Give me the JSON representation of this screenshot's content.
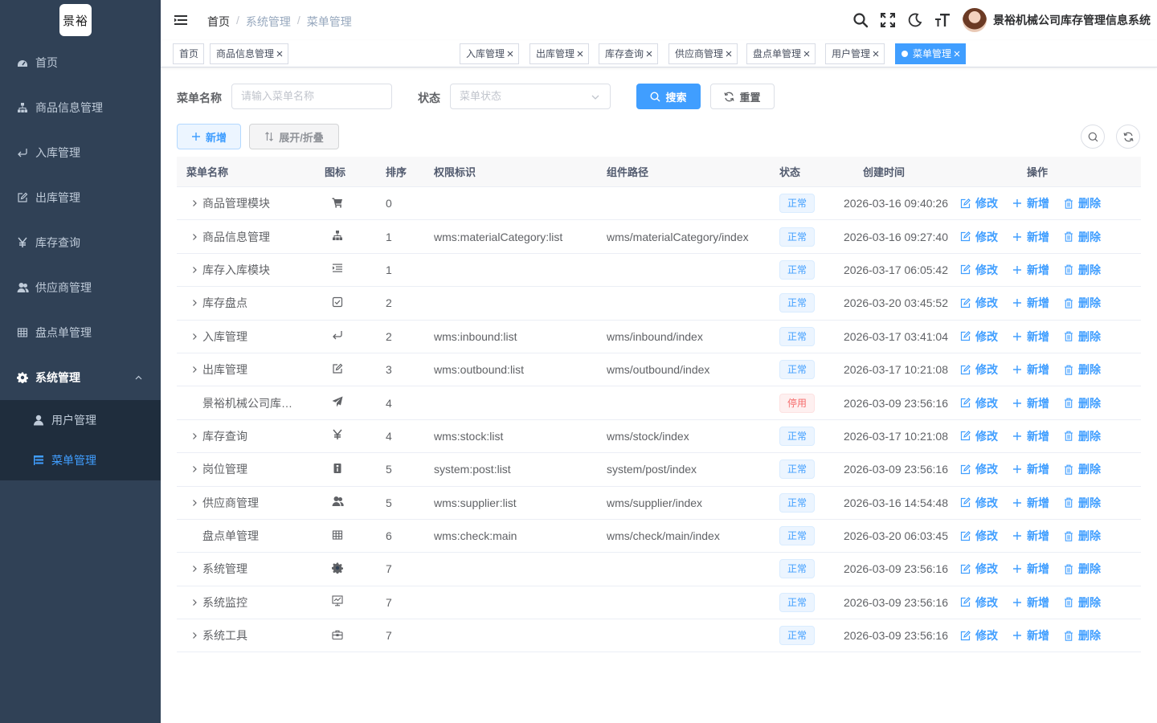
{
  "logo": {
    "text": "景裕"
  },
  "sidebar": {
    "items": [
      {
        "label": "首页",
        "icon": "dashboard-icon"
      },
      {
        "label": "商品信息管理",
        "icon": "tree-icon"
      },
      {
        "label": "入库管理",
        "icon": "enter-icon"
      },
      {
        "label": "出库管理",
        "icon": "edit-icon"
      },
      {
        "label": "库存查询",
        "icon": "yen-icon"
      },
      {
        "label": "供应商管理",
        "icon": "peoples-icon"
      },
      {
        "label": "盘点单管理",
        "icon": "table-icon"
      },
      {
        "label": "系统管理",
        "icon": "gear-icon"
      }
    ],
    "sub_items": [
      {
        "label": "用户管理",
        "icon": "user-icon"
      },
      {
        "label": "菜单管理",
        "icon": "tree-table-icon"
      }
    ]
  },
  "navbar": {
    "breadcrumb": [
      "首页",
      "系统管理",
      "菜单管理"
    ],
    "system_name": "景裕机械公司库存管理信息系统"
  },
  "tags": [
    {
      "label": "首页",
      "closable": false
    },
    {
      "label": "商品信息管理",
      "closable": true
    },
    {
      "label": "入库管理",
      "closable": true
    },
    {
      "label": "出库管理",
      "closable": true
    },
    {
      "label": "库存查询",
      "closable": true
    },
    {
      "label": "供应商管理",
      "closable": true
    },
    {
      "label": "盘点单管理",
      "closable": true
    },
    {
      "label": "用户管理",
      "closable": true
    },
    {
      "label": "菜单管理",
      "closable": true,
      "active": true
    }
  ],
  "search": {
    "name_label": "菜单名称",
    "name_placeholder": "请输入菜单名称",
    "status_label": "状态",
    "status_placeholder": "菜单状态",
    "search_button": "搜索",
    "reset_button": "重置"
  },
  "toolbar": {
    "add_button": "新增",
    "expand_button": "展开/折叠"
  },
  "table": {
    "columns": [
      "菜单名称",
      "图标",
      "排序",
      "权限标识",
      "组件路径",
      "状态",
      "创建时间",
      "操作"
    ],
    "ops": {
      "edit": "修改",
      "add": "新增",
      "delete": "删除"
    },
    "rows": [
      {
        "name": "商品管理模块",
        "expandable": true,
        "icon": "shopping-cart-icon",
        "sort": "0",
        "perm": "",
        "comp": "",
        "status": "正常",
        "time": "2026-03-16 09:40:26"
      },
      {
        "name": "商品信息管理",
        "expandable": true,
        "icon": "tree-icon",
        "sort": "1",
        "perm": "wms:materialCategory:list",
        "comp": "wms/materialCategory/index",
        "status": "正常",
        "time": "2026-03-16 09:27:40"
      },
      {
        "name": "库存入库模块",
        "expandable": true,
        "icon": "list-indent-icon",
        "sort": "1",
        "perm": "",
        "comp": "",
        "status": "正常",
        "time": "2026-03-17 06:05:42"
      },
      {
        "name": "库存盘点",
        "expandable": true,
        "icon": "checkbox-icon",
        "sort": "2",
        "perm": "",
        "comp": "",
        "status": "正常",
        "time": "2026-03-20 03:45:52"
      },
      {
        "name": "入库管理",
        "expandable": true,
        "icon": "enter-icon",
        "sort": "2",
        "perm": "wms:inbound:list",
        "comp": "wms/inbound/index",
        "status": "正常",
        "time": "2026-03-17 03:41:04"
      },
      {
        "name": "出库管理",
        "expandable": true,
        "icon": "edit-icon",
        "sort": "3",
        "perm": "wms:outbound:list",
        "comp": "wms/outbound/index",
        "status": "正常",
        "time": "2026-03-17 10:21:08"
      },
      {
        "name": "景裕机械公司库存管理信息系统",
        "expandable": false,
        "icon": "send-icon",
        "sort": "4",
        "perm": "",
        "comp": "",
        "status": "停用",
        "disabled": true,
        "time": "2026-03-09 23:56:16"
      },
      {
        "name": "库存查询",
        "expandable": true,
        "icon": "yen-icon",
        "sort": "4",
        "perm": "wms:stock:list",
        "comp": "wms/stock/index",
        "status": "正常",
        "time": "2026-03-17 10:21:08"
      },
      {
        "name": "岗位管理",
        "expandable": true,
        "icon": "post-icon",
        "sort": "5",
        "perm": "system:post:list",
        "comp": "system/post/index",
        "status": "正常",
        "time": "2026-03-09 23:56:16"
      },
      {
        "name": "供应商管理",
        "expandable": true,
        "icon": "peoples-icon",
        "sort": "5",
        "perm": "wms:supplier:list",
        "comp": "wms/supplier/index",
        "status": "正常",
        "time": "2026-03-16 14:54:48"
      },
      {
        "name": "盘点单管理",
        "expandable": false,
        "icon": "table-icon",
        "sort": "6",
        "perm": "wms:check:main",
        "comp": "wms/check/main/index",
        "status": "正常",
        "time": "2026-03-20 06:03:45"
      },
      {
        "name": "系统管理",
        "expandable": true,
        "icon": "gear-icon",
        "sort": "7",
        "perm": "",
        "comp": "",
        "status": "正常",
        "time": "2026-03-09 23:56:16"
      },
      {
        "name": "系统监控",
        "expandable": true,
        "icon": "monitor-icon",
        "sort": "7",
        "perm": "",
        "comp": "",
        "status": "正常",
        "time": "2026-03-09 23:56:16"
      },
      {
        "name": "系统工具",
        "expandable": true,
        "icon": "toolbox-icon",
        "sort": "7",
        "perm": "",
        "comp": "",
        "status": "正常",
        "time": "2026-03-09 23:56:16"
      }
    ]
  },
  "colors": {
    "sidebar_bg": "#304156",
    "submenu_bg": "#1f2d3d",
    "primary": "#409eff",
    "danger": "#f56c6c"
  }
}
